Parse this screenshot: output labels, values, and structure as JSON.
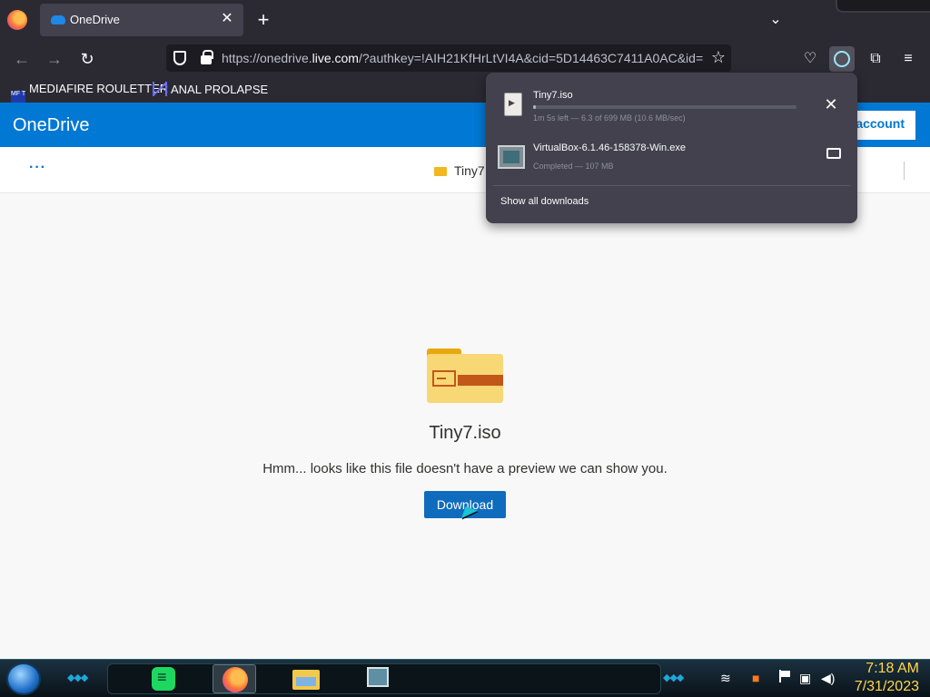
{
  "browser": {
    "tab": {
      "title": "OneDrive",
      "close_glyph": "✕"
    },
    "new_tab_glyph": "+",
    "tab_list_glyph": "⌄",
    "nav": {
      "back_glyph": "←",
      "forward_glyph": "→",
      "reload_glyph": "↻"
    },
    "url": {
      "prefix": "https://onedrive.",
      "host": "live.com",
      "rest": "/?authkey=!AIH21KfHrLtVI4A&cid=5D14463C7411A0AC&id="
    },
    "star_glyph": "☆",
    "toolbar": {
      "pocket_glyph": "♡",
      "extensions_glyph": "⧉",
      "menu_glyph": "≡"
    },
    "bookmarks": [
      {
        "label": "MEDIAFIRE ROULETTER",
        "icon": "mf-icon",
        "icon_text": "MF T"
      },
      {
        "label": "ANAL PROLAPSE",
        "icon": "sigma-icon"
      }
    ]
  },
  "onedrive": {
    "brand": "OneDrive",
    "signin_label": "account",
    "more_glyph": "···",
    "breadcrumb": "Tiny7",
    "file": {
      "name": "Tiny7.iso",
      "message": "Hmm... looks like this file doesn't have a preview we can show you.",
      "download_label": "Download"
    }
  },
  "downloads": {
    "items": [
      {
        "name": "Tiny7.iso",
        "status": "1m 5s left — 6.3 of 699 MB (10.6 MB/sec)",
        "progress": 0.009,
        "action": "cancel"
      },
      {
        "name": "VirtualBox-6.1.46-158378-Win.exe",
        "status": "Completed — 107 MB",
        "action": "open-folder"
      }
    ],
    "show_all_label": "Show all downloads"
  },
  "taskbar": {
    "apps": [
      "notes-app-icon",
      "firefox-icon",
      "file-explorer-icon",
      "my-computer-icon"
    ],
    "time": "7:18 AM",
    "date": "7/31/2023"
  },
  "colors": {
    "onedrive_blue": "#0078d4",
    "download_button": "#0f6cbd",
    "browser_chrome": "#2b2a33",
    "clock": "#ffd84a"
  }
}
